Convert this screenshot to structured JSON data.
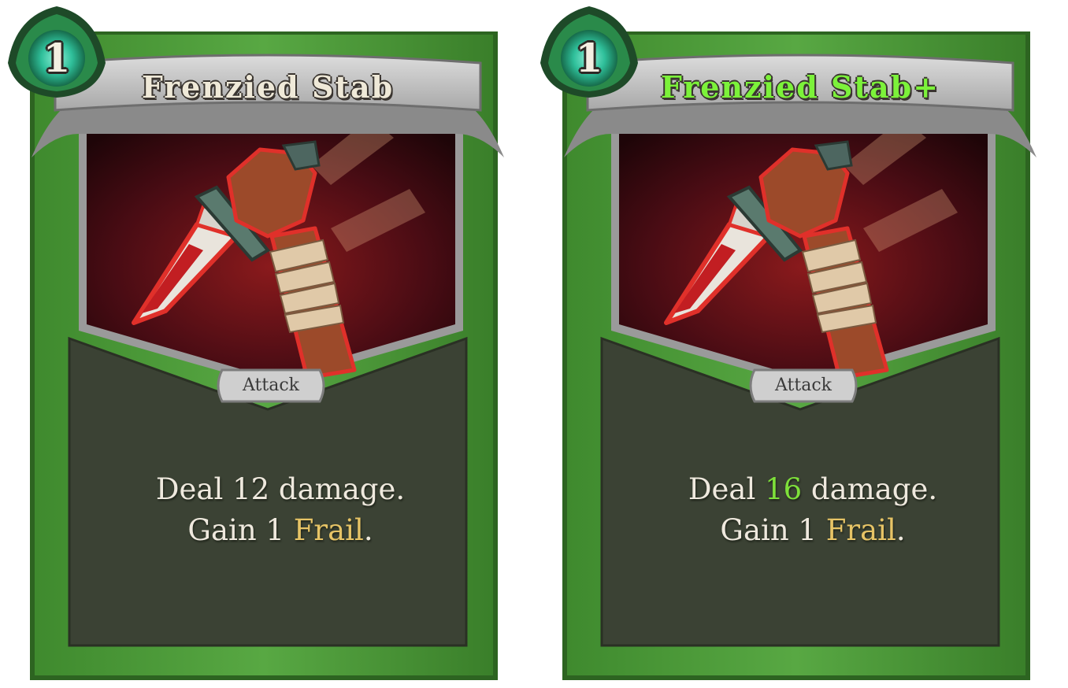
{
  "cards": [
    {
      "cost": "1",
      "title": "Frenzied Stab",
      "type": "Attack",
      "description": {
        "line1_prefix": "Deal ",
        "damage": "12",
        "line1_suffix": " damage.",
        "line2_prefix": "Gain 1 ",
        "keyword": "Frail",
        "line2_suffix": "."
      },
      "upgraded": false
    },
    {
      "cost": "1",
      "title": "Frenzied Stab+",
      "type": "Attack",
      "description": {
        "line1_prefix": "Deal ",
        "damage": "16",
        "line1_suffix": " damage.",
        "line2_prefix": "Gain 1 ",
        "keyword": "Frail",
        "line2_suffix": "."
      },
      "upgraded": true
    }
  ],
  "colors": {
    "frame_green": "#4e9a3a",
    "frame_dark": "#2f6a24",
    "body_dark": "#3b4234",
    "banner_gray": "#c9c9c9",
    "art_bg": "#3a0a12",
    "title_upgrade": "#7cf23a",
    "keyword_gold": "#e7c466",
    "upgrade_value": "#7ee03a"
  }
}
